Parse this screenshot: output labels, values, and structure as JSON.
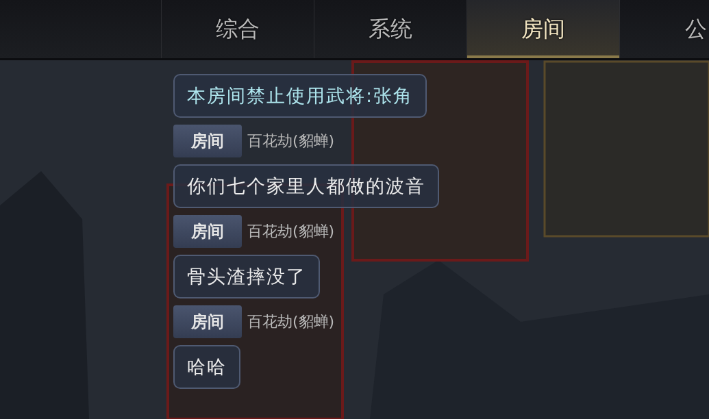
{
  "tabs": [
    {
      "label": "综合",
      "selected": false
    },
    {
      "label": "系统",
      "selected": false
    },
    {
      "label": "房间",
      "selected": true
    },
    {
      "label": "公",
      "selected": false
    }
  ],
  "chat": [
    {
      "kind": "notice",
      "text": "本房间禁止使用武将:张角"
    },
    {
      "kind": "sender",
      "channel": "房间",
      "name": "百花劫(貂蝉)"
    },
    {
      "kind": "message",
      "text": "你们七个家里人都做的波音"
    },
    {
      "kind": "sender",
      "channel": "房间",
      "name": "百花劫(貂蝉)"
    },
    {
      "kind": "message",
      "text": "骨头渣摔没了"
    },
    {
      "kind": "sender",
      "channel": "房间",
      "name": "百花劫(貂蝉)"
    },
    {
      "kind": "message",
      "text": "哈哈"
    }
  ]
}
